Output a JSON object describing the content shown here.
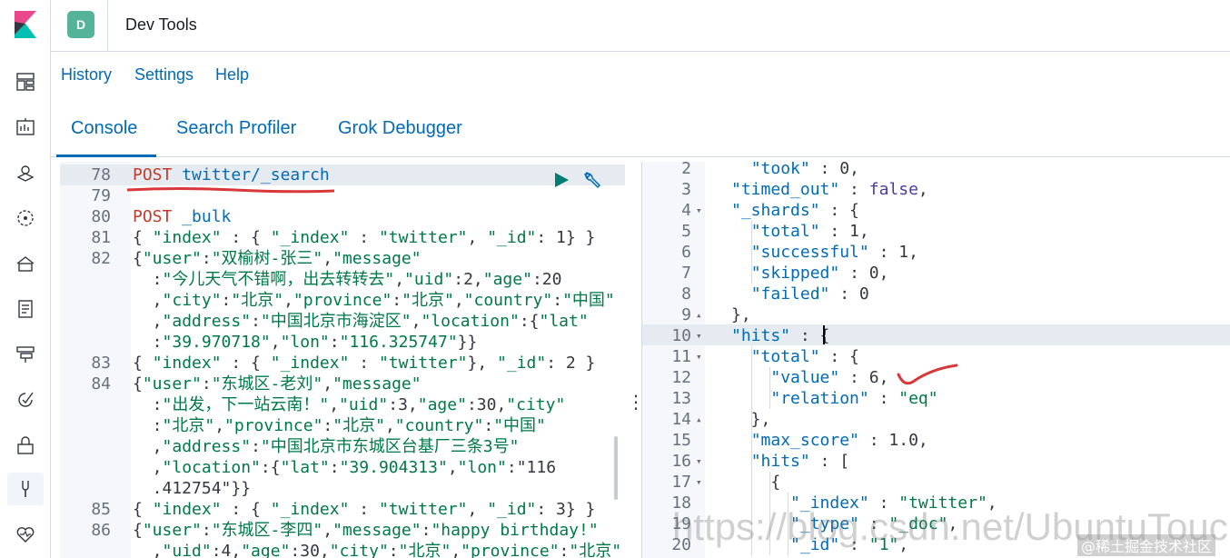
{
  "header": {
    "space_initial": "D",
    "app_title": "Dev Tools"
  },
  "menu": {
    "history": "History",
    "settings": "Settings",
    "help": "Help"
  },
  "tabs": [
    {
      "label": "Console",
      "active": true
    },
    {
      "label": "Search Profiler",
      "active": false
    },
    {
      "label": "Grok Debugger",
      "active": false
    }
  ],
  "sidebar": {
    "icons": [
      "dashboard-icon",
      "canvas-icon",
      "maps-icon",
      "ml-icon",
      "infrastructure-icon",
      "logs-icon",
      "apm-icon",
      "uptime-icon",
      "siem-icon",
      "dev-tools-icon",
      "monitoring-icon"
    ]
  },
  "editor": {
    "lines": [
      {
        "num": "78",
        "text": "POST twitter/_search"
      },
      {
        "num": "79",
        "text": ""
      },
      {
        "num": "80",
        "text": "POST _bulk"
      },
      {
        "num": "81",
        "text": "{ \"index\" : { \"_index\" : \"twitter\", \"_id\": 1} }"
      },
      {
        "num": "82",
        "text": "{\"user\":\"双榆树-张三\",\"message\""
      },
      {
        "num": "",
        "text": "  :\"今儿天气不错啊，出去转转去\",\"uid\":2,\"age\":20"
      },
      {
        "num": "",
        "text": "  ,\"city\":\"北京\",\"province\":\"北京\",\"country\":\"中国\""
      },
      {
        "num": "",
        "text": "  ,\"address\":\"中国北京市海淀区\",\"location\":{\"lat\""
      },
      {
        "num": "",
        "text": "  :\"39.970718\",\"lon\":\"116.325747\"}}"
      },
      {
        "num": "83",
        "text": "{ \"index\" : { \"_index\" : \"twitter\"}, \"_id\": 2 }"
      },
      {
        "num": "84",
        "text": "{\"user\":\"东城区-老刘\",\"message\""
      },
      {
        "num": "",
        "text": "  :\"出发，下一站云南！\",\"uid\":3,\"age\":30,\"city\""
      },
      {
        "num": "",
        "text": "  :\"北京\",\"province\":\"北京\",\"country\":\"中国\""
      },
      {
        "num": "",
        "text": "  ,\"address\":\"中国北京市东城区台基厂三条3号\""
      },
      {
        "num": "",
        "text": "  ,\"location\":{\"lat\":\"39.904313\",\"lon\":\"116"
      },
      {
        "num": "",
        "text": "  .412754\"}}"
      },
      {
        "num": "85",
        "text": "{ \"index\" : { \"_index\" : \"twitter\", \"_id\": 3} }"
      },
      {
        "num": "86",
        "text": "{\"user\":\"东城区-李四\",\"message\":\"happy birthday!\""
      },
      {
        "num": "",
        "text": "  ,\"uid\":4,\"age\":30,\"city\":\"北京\",\"province\":\"北京\""
      }
    ]
  },
  "output": {
    "lines": [
      {
        "num": "2",
        "fold": "",
        "text": "  \"took\" : 0,"
      },
      {
        "num": "3",
        "fold": "",
        "text": "\"timed_out\" : false,"
      },
      {
        "num": "4",
        "fold": "▾",
        "text": "\"_shards\" : {"
      },
      {
        "num": "5",
        "fold": "",
        "text": "  \"total\" : 1,"
      },
      {
        "num": "6",
        "fold": "",
        "text": "  \"successful\" : 1,"
      },
      {
        "num": "7",
        "fold": "",
        "text": "  \"skipped\" : 0,"
      },
      {
        "num": "8",
        "fold": "",
        "text": "  \"failed\" : 0"
      },
      {
        "num": "9",
        "fold": "▴",
        "text": "},"
      },
      {
        "num": "10",
        "fold": "▾",
        "text": "\"hits\" : {"
      },
      {
        "num": "11",
        "fold": "▾",
        "text": "  \"total\" : {"
      },
      {
        "num": "12",
        "fold": "",
        "text": "    \"value\" : 6,"
      },
      {
        "num": "13",
        "fold": "",
        "text": "    \"relation\" : \"eq\""
      },
      {
        "num": "14",
        "fold": "▴",
        "text": "  },"
      },
      {
        "num": "15",
        "fold": "",
        "text": "  \"max_score\" : 1.0,"
      },
      {
        "num": "16",
        "fold": "▾",
        "text": "  \"hits\" : ["
      },
      {
        "num": "17",
        "fold": "▾",
        "text": "    {"
      },
      {
        "num": "18",
        "fold": "",
        "text": "      \"_index\" : \"twitter\","
      },
      {
        "num": "19",
        "fold": "",
        "text": "      \"_type\" : \"_doc\","
      },
      {
        "num": "20",
        "fold": "",
        "text": "      \"_id\" : \"1\","
      }
    ]
  },
  "watermark": {
    "url": "https://blog.csdn.net/UbuntuTouch",
    "site": "@稀土掘金技术社区"
  }
}
